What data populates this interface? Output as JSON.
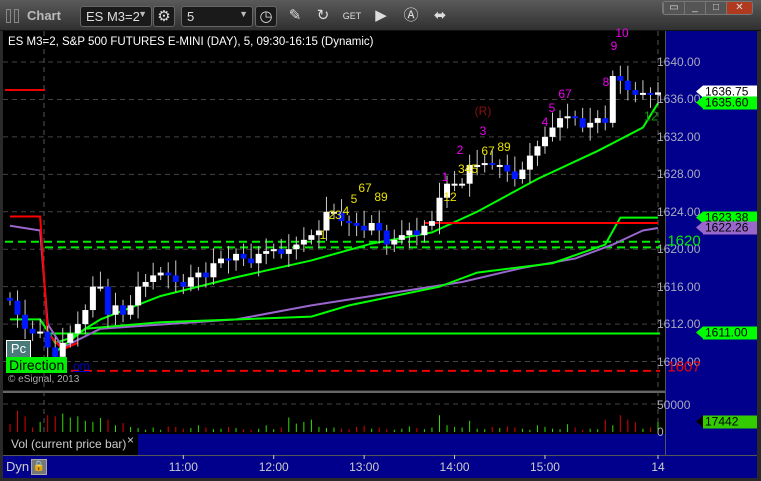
{
  "window": {
    "title": "Chart",
    "symbol": "ES M3=2",
    "interval": "5"
  },
  "chart_header": "ES M3=2, S&P 500 FUTURES E-MINI (DAY), 5, 09:30-16:15 (Dynamic)",
  "overlays": {
    "pc_label": "Pc",
    "direction_label": "Direction",
    "om_link": "om",
    "copyright": "© eSignal, 2013",
    "level_1620": "1620",
    "level_1607": "1607"
  },
  "volume_pane": {
    "label": "Vol (current price bar)",
    "close": "×",
    "ticks": [
      "50000",
      "0"
    ],
    "current": "17442"
  },
  "bottom": {
    "dyn": "Dyn"
  },
  "colors": {
    "up": "#ffffff",
    "down": "#0018ff",
    "ema": "#00ff00",
    "purple": "#9966cc",
    "red": "#ff0000",
    "axis_bg": "#00008c"
  },
  "annotations": [
    {
      "text": "1",
      "color": "#e8e000"
    },
    {
      "text": "23",
      "color": "#e8e000"
    },
    {
      "text": "4",
      "color": "#e8e000"
    },
    {
      "text": "5",
      "color": "#e8e000"
    },
    {
      "text": "67",
      "color": "#e8e000"
    },
    {
      "text": "89",
      "color": "#e8e000"
    },
    {
      "text": "12",
      "color": "#e8e000"
    },
    {
      "text": "345",
      "color": "#e8e000"
    },
    {
      "text": "67",
      "color": "#e8e000"
    },
    {
      "text": "89",
      "color": "#e8e000"
    },
    {
      "text": "1",
      "color": "#ee00ee"
    },
    {
      "text": "2",
      "color": "#ee00ee"
    },
    {
      "text": "3",
      "color": "#ee00ee"
    },
    {
      "text": "(R)",
      "color": "#8b1010"
    },
    {
      "text": "4",
      "color": "#ee00ee"
    },
    {
      "text": "5",
      "color": "#ee00ee"
    },
    {
      "text": "67",
      "color": "#ee00ee"
    },
    {
      "text": "8",
      "color": "#ee00ee"
    },
    {
      "text": "9",
      "color": "#ee00ee"
    },
    {
      "text": "10",
      "color": "#ee00ee"
    },
    {
      "text": "12",
      "color": "#119911"
    }
  ],
  "chart_data": {
    "type": "candlestick",
    "title": "ES M3=2, S&P 500 FUTURES E-MINI (DAY), 5, 09:30-16:15 (Dynamic)",
    "ylim": [
      1604.5,
      1643.5
    ],
    "y_ticks": [
      "1640.00",
      "1636.00",
      "1632.00",
      "1628.00",
      "1624.00",
      "1620.00",
      "1616.00",
      "1612.00",
      "1608.00"
    ],
    "y_tick_values": [
      1640,
      1636,
      1632,
      1628,
      1624,
      1620,
      1616,
      1612,
      1608
    ],
    "x_ticks": [
      "11:00",
      "12:00",
      "13:00",
      "14:00",
      "15:00",
      "14"
    ],
    "x_tick_bars": [
      23,
      35,
      47,
      59,
      71,
      86
    ],
    "closes": [
      1614.5,
      1613,
      1611.5,
      1611,
      1611.2,
      1609.5,
      1608.5,
      1610,
      1611,
      1612,
      1613.5,
      1616,
      1616,
      1613,
      1614,
      1613,
      1614,
      1616,
      1616.5,
      1617.2,
      1617.5,
      1617.2,
      1616.5,
      1616,
      1617,
      1617.5,
      1617,
      1618.5,
      1619,
      1618.8,
      1619.5,
      1619,
      1618.5,
      1619.5,
      1619.8,
      1620,
      1619.5,
      1620,
      1620.5,
      1621,
      1621.5,
      1622,
      1624,
      1624,
      1623,
      1622.8,
      1622.5,
      1622,
      1622.8,
      1622,
      1620.5,
      1621,
      1621.5,
      1622,
      1621.5,
      1622.5,
      1623,
      1625.5,
      1627,
      1627,
      1627,
      1629,
      1629,
      1629.2,
      1629,
      1629,
      1628.3,
      1627.5,
      1628.5,
      1630,
      1631,
      1632,
      1633,
      1634,
      1634.2,
      1634,
      1633,
      1633.5,
      1634,
      1633.5,
      1638.5,
      1638,
      1637,
      1636.5,
      1636.7,
      1636.5,
      1636.75
    ],
    "volume": [
      14000,
      38000,
      28000,
      8000,
      18000,
      30000,
      28000,
      33000,
      26000,
      28000,
      20000,
      18000,
      25000,
      22000,
      12000,
      16000,
      9000,
      7000,
      4000,
      8000,
      4000,
      10000,
      9000,
      6000,
      7000,
      12000,
      8000,
      5000,
      6000,
      9000,
      7000,
      5000,
      4000,
      6000,
      12000,
      5000,
      8000,
      26000,
      15000,
      18000,
      22000,
      9000,
      7000,
      8000,
      6000,
      5000,
      9000,
      11000,
      6000,
      8000,
      5000,
      4000,
      6000,
      10000,
      7000,
      5000,
      8000,
      30000,
      12000,
      9000,
      8000,
      20000,
      6000,
      5000,
      9000,
      7000,
      10000,
      8000,
      6000,
      4000,
      12000,
      9000,
      6000,
      5000,
      14000,
      8000,
      4000,
      6000,
      5000,
      22000,
      12000,
      30000,
      22000,
      17442,
      6000,
      8000,
      17442
    ],
    "series": [
      {
        "name": "EMA",
        "color": "#00ff00",
        "points": [
          [
            0,
            1612.5
          ],
          [
            4,
            1612.5
          ],
          [
            6,
            1610
          ],
          [
            8,
            1610.5
          ],
          [
            12,
            1612.5
          ],
          [
            20,
            1615
          ],
          [
            30,
            1617
          ],
          [
            40,
            1618.8
          ],
          [
            48,
            1620.6
          ],
          [
            56,
            1621.8
          ],
          [
            62,
            1624
          ],
          [
            70,
            1627.5
          ],
          [
            78,
            1630.5
          ],
          [
            84,
            1633
          ],
          [
            86,
            1635.6
          ]
        ]
      },
      {
        "name": "Purple",
        "color": "#9966cc",
        "points": [
          [
            0,
            1622.5
          ],
          [
            4,
            1622
          ],
          [
            5,
            1612
          ],
          [
            7,
            1609.5
          ],
          [
            12,
            1611.5
          ],
          [
            30,
            1612.5
          ],
          [
            40,
            1614
          ],
          [
            48,
            1615
          ],
          [
            60,
            1616.5
          ],
          [
            68,
            1618
          ],
          [
            75,
            1619
          ],
          [
            80,
            1620.5
          ],
          [
            84,
            1622
          ],
          [
            86,
            1622.26
          ]
        ]
      },
      {
        "name": "Step",
        "color": "#00ff00",
        "points": [
          [
            6,
            1609
          ],
          [
            10,
            1611.5
          ],
          [
            20,
            1612.2
          ],
          [
            40,
            1612.8
          ],
          [
            45,
            1614
          ],
          [
            57,
            1616
          ],
          [
            62,
            1617.5
          ],
          [
            72,
            1618.5
          ],
          [
            79,
            1620.5
          ],
          [
            81,
            1623.38
          ],
          [
            86,
            1623.38
          ]
        ]
      },
      {
        "name": "Red",
        "color": "#ff0000",
        "points": [
          [
            0,
            1623.5
          ],
          [
            4,
            1623.5
          ],
          [
            5,
            1611
          ],
          [
            7,
            1609.3
          ],
          [
            9,
            1610
          ]
        ]
      },
      {
        "name": "RedLevel",
        "color": "#ff0000",
        "points": [
          [
            55,
            1622.8
          ],
          [
            86,
            1622.8
          ]
        ]
      }
    ],
    "levels": [
      {
        "value": 1620.8,
        "style": "dashed",
        "color": "#00ee00"
      },
      {
        "value": 1620.2,
        "style": "dashed",
        "color": "#00ee00"
      },
      {
        "value": 1611,
        "style": "solid",
        "color": "#00ff00"
      },
      {
        "value": 1607,
        "style": "dashed",
        "color": "#ee0000"
      }
    ],
    "price_tags": [
      {
        "value": "1636.75",
        "bg": "#ffffff"
      },
      {
        "value": "1635.60",
        "bg": "#00ff00"
      },
      {
        "value": "1623.38",
        "bg": "#00ff00"
      },
      {
        "value": "1622.26",
        "bg": "#9966cc"
      },
      {
        "value": "1611.00",
        "bg": "#00ff00"
      }
    ]
  }
}
